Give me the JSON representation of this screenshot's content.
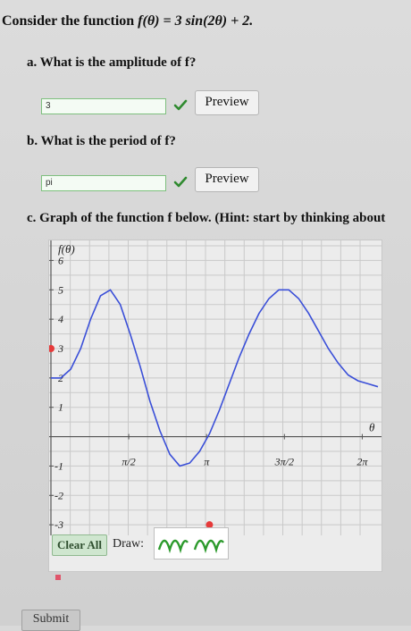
{
  "question": {
    "title_prefix": "Consider the function ",
    "title_formula": "f(θ) = 3 sin(2θ) + 2."
  },
  "part_a": {
    "prompt": "a. What is the amplitude of f?",
    "answer_value": "3",
    "preview_label": "Preview",
    "status": "correct"
  },
  "part_b": {
    "prompt": "b. What is the period of f?",
    "answer_value": "pi",
    "preview_label": "Preview",
    "status": "correct"
  },
  "part_c": {
    "prompt": "c. Graph of the function f below. (Hint: start by thinking about"
  },
  "graph": {
    "y_axis_label": "f(θ)",
    "x_axis_label": "θ",
    "y_ticks": [
      "6",
      "5",
      "4",
      "3",
      "2",
      "1",
      "-1",
      "-2",
      "-3"
    ],
    "x_ticks": [
      "π/2",
      "π",
      "3π/2",
      "2π"
    ],
    "curve_color": "#3a4fd8",
    "point_color": "#e63a3a"
  },
  "chart_data": {
    "type": "line",
    "title": "",
    "xlabel": "θ",
    "ylabel": "f(θ)",
    "xlim": [
      0,
      6.6
    ],
    "ylim": [
      -3.3,
      6.5
    ],
    "x_tick_values": [
      1.5708,
      3.1416,
      4.7124,
      6.2832
    ],
    "x_tick_labels": [
      "π/2",
      "π",
      "3π/2",
      "2π"
    ],
    "y_tick_values": [
      6,
      5,
      4,
      3,
      2,
      1,
      -1,
      -2,
      -3
    ],
    "series": [
      {
        "function": "3 sin(2θ) + 2",
        "x": [
          0,
          0.2,
          0.4,
          0.6,
          0.8,
          1.0,
          1.2,
          1.4,
          1.6,
          1.8,
          2.0,
          2.2,
          2.4,
          2.6,
          2.8,
          3.0,
          3.2,
          3.4,
          3.6,
          3.8,
          4.0,
          4.2,
          4.4,
          4.6,
          4.8,
          5.0,
          5.2,
          5.4,
          5.6,
          5.8,
          6.0,
          6.2,
          6.4,
          6.6
        ],
        "y": [
          2.0,
          2.0,
          2.3,
          3.0,
          4.0,
          4.8,
          5.0,
          4.5,
          3.5,
          2.4,
          1.2,
          0.2,
          -0.6,
          -1.0,
          -0.9,
          -0.5,
          0.1,
          0.9,
          1.8,
          2.7,
          3.5,
          4.2,
          4.7,
          5.0,
          5.0,
          4.7,
          4.2,
          3.6,
          3.0,
          2.5,
          2.1,
          1.9,
          1.8,
          1.7
        ]
      }
    ],
    "points": [
      {
        "x": 0.0,
        "y": 3.0
      },
      {
        "x": 3.2,
        "y": -3.0
      }
    ],
    "grid": true
  },
  "controls": {
    "clear_all_label": "Clear All",
    "draw_label": "Draw:",
    "submit_label": "Submit"
  }
}
